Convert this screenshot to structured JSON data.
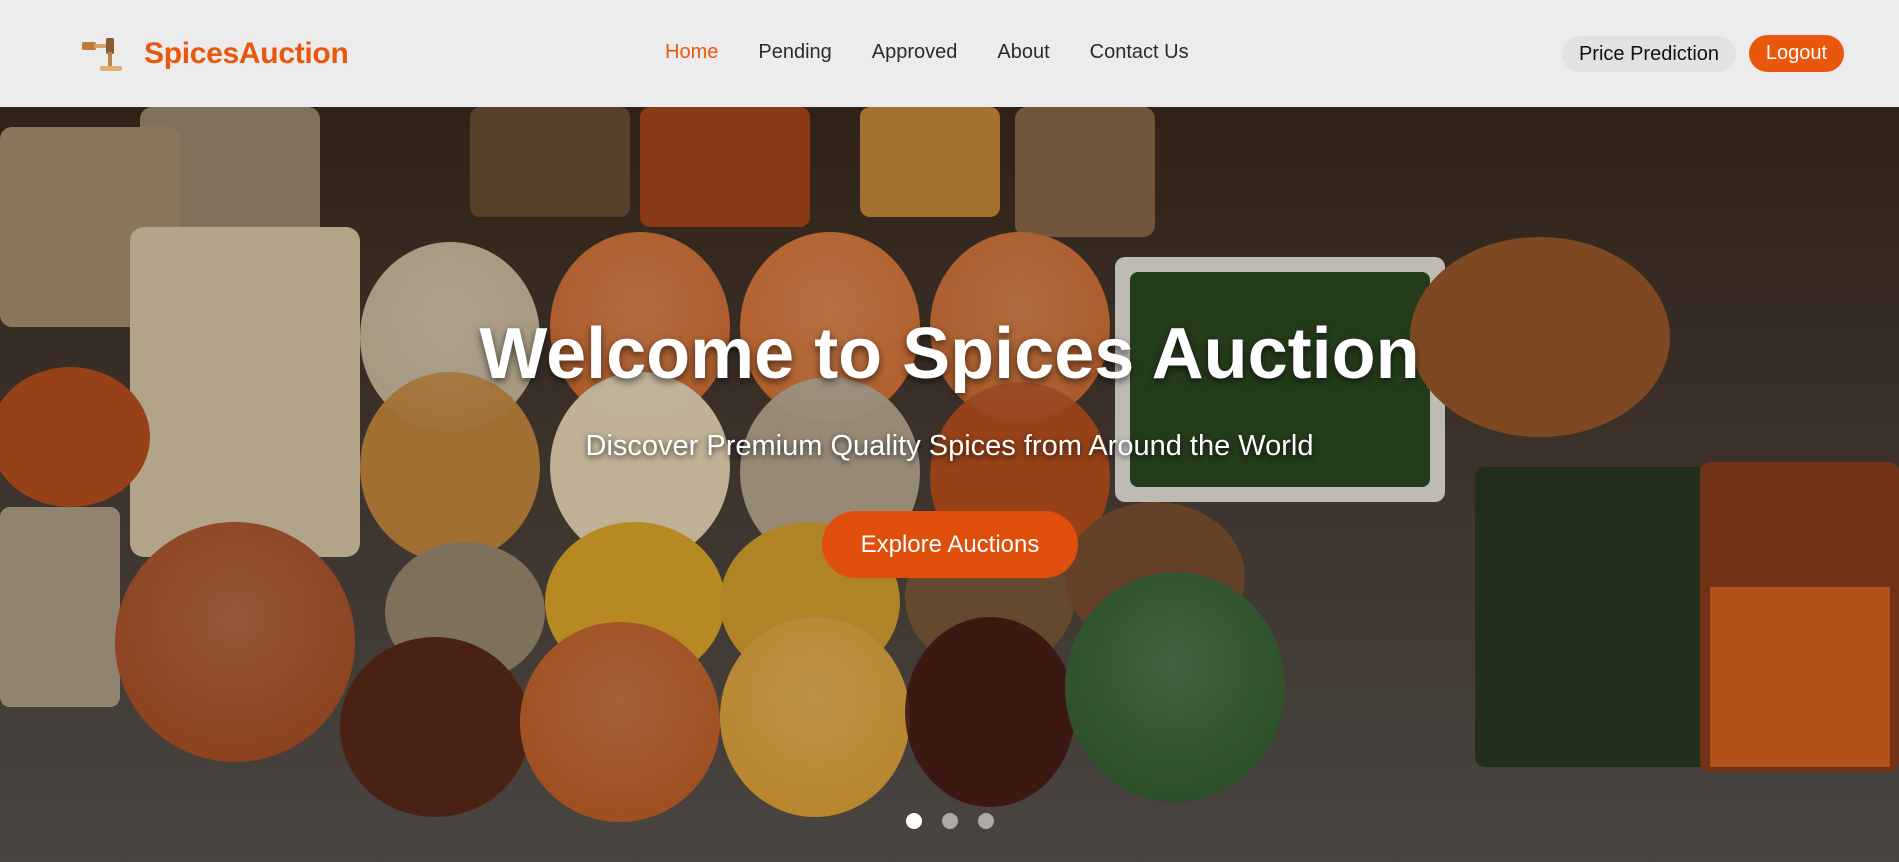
{
  "brand": {
    "name": "SpicesAuction",
    "logo_icon": "gavel-icon",
    "color": "#e8570c"
  },
  "nav": {
    "links": [
      {
        "label": "Home",
        "active": true
      },
      {
        "label": "Pending",
        "active": false
      },
      {
        "label": "Approved",
        "active": false
      },
      {
        "label": "About",
        "active": false
      },
      {
        "label": "Contact Us",
        "active": false
      }
    ],
    "price_prediction_label": "Price Prediction",
    "logout_label": "Logout"
  },
  "hero": {
    "title": "Welcome to Spices Auction",
    "subtitle": "Discover Premium Quality Spices from Around the World",
    "cta_label": "Explore Auctions",
    "carousel": {
      "slides": 3,
      "active_index": 0
    }
  },
  "colors": {
    "accent": "#e8570c",
    "nav_bg": "#f6f6f6"
  }
}
